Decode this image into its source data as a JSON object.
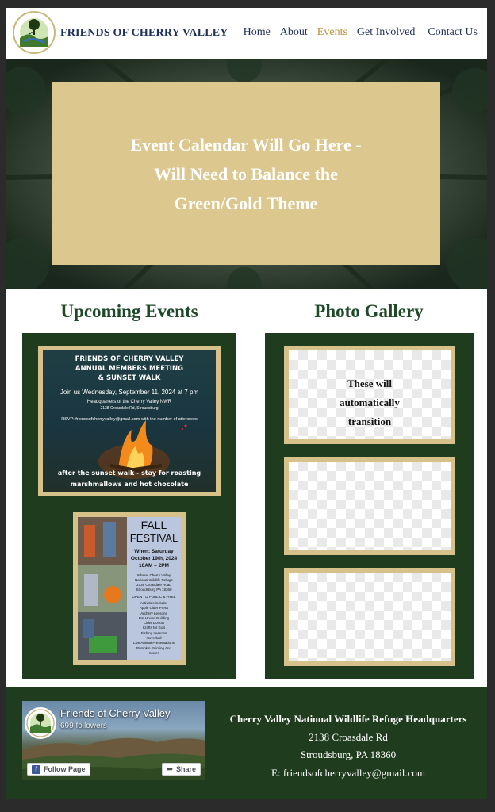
{
  "site": {
    "title": "FRIENDS OF CHERRY VALLEY",
    "logo_icon": "cherry-valley-logo-icon"
  },
  "nav": {
    "items": [
      {
        "label": "Home",
        "active": false
      },
      {
        "label": "About",
        "active": false
      },
      {
        "label": "Events",
        "active": true
      },
      {
        "label": "Get Involved",
        "active": false
      },
      {
        "label": "Contact Us",
        "active": false
      }
    ],
    "link_color": "#1d2f5c",
    "active_color": "#b8923a"
  },
  "hero": {
    "text": "Event Calendar Will Go Here - Will Need to Balance the Green/Gold Theme",
    "box_color": "#dcc78f"
  },
  "events": {
    "heading": "Upcoming Events",
    "flyer1": {
      "title_line1": "FRIENDS OF CHERRY VALLEY",
      "title_line2": "ANNUAL MEMBERS MEETING",
      "title_line3": "& SUNSET WALK",
      "date_line": "Join us Wednesday, September 11, 2024 at 7 pm",
      "location_line1": "Headquarters of the Cherry Valley NWR",
      "location_line2": "2138 Croasdale Rd, Stroudsburg",
      "rsvp_line": "RSVP:  friendsofcherryvalley@gmail.com with the number of attendees",
      "bottom_line1": "after the sunset walk - stay for roasting",
      "bottom_line2": "marshmallows and hot chocolate"
    },
    "flyer2": {
      "title_line1": "FALL",
      "title_line2": "FESTIVAL",
      "when_label": "When: Saturday",
      "when_date": "October 19th, 2024",
      "when_time": "10AM – 2PM",
      "where_line1": "Where: Cherry Valley",
      "where_line2": "National Wildlife Refuge",
      "where_line3": "2138 Croasdale Road",
      "where_line4": "Stroudsburg PA 18360",
      "open_line": "OPEN TO PUBLIC & FREE",
      "activities": [
        "Activities include:",
        "Apple Cider Press",
        "Archery Lessons",
        "Bat House Building",
        "Cider Donuts",
        "Crafts for Kids",
        "Fishing Lessons",
        "Hoverball",
        "Live Animal Presentations",
        "Pumpkin Painting And",
        "More!"
      ]
    }
  },
  "gallery": {
    "heading": "Photo Gallery",
    "caption_line1": "These will",
    "caption_line2": "automatically",
    "caption_line3": "transition"
  },
  "footer": {
    "fb_page_name": "Friends of Cherry Valley",
    "fb_followers": "699 followers",
    "fb_follow_label": "Follow Page",
    "fb_share_label": "Share",
    "hq_name": "Cherry Valley National Wildlife Refuge Headquarters",
    "address_line1": "2138 Croasdale Rd",
    "address_line2": "Stroudsburg, PA 18360",
    "email_line": "E: friendsofcherryvalley@gmail.com"
  },
  "colors": {
    "forest_green": "#203c1e",
    "heading_green": "#1f4a2a",
    "gold": "#d6c18b"
  }
}
